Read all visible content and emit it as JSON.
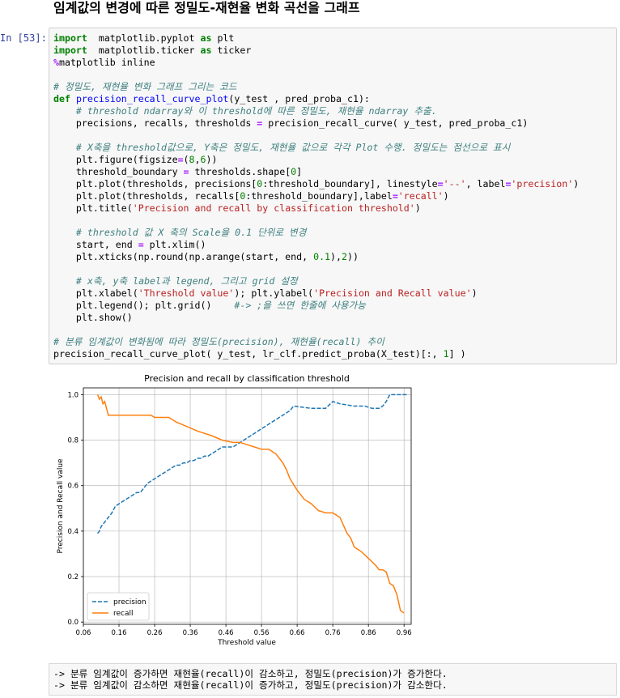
{
  "heading": "임계값의 변경에 따른 정밀도-재현율 변화 곡선을 그래프",
  "cell": {
    "prompt": "In [53]:",
    "lines": [
      [
        [
          "kw",
          "import"
        ],
        [
          "",
          "  matplotlib.pyplot "
        ],
        [
          "kw",
          "as"
        ],
        [
          "",
          " plt"
        ]
      ],
      [
        [
          "kw",
          "import"
        ],
        [
          "",
          "  matplotlib.ticker "
        ],
        [
          "kw",
          "as"
        ],
        [
          "",
          " ticker"
        ]
      ],
      [
        [
          "op",
          "%"
        ],
        [
          "",
          "matplotlib inline"
        ]
      ],
      [
        [
          "",
          ""
        ]
      ],
      [
        [
          "cm",
          "# 정밀도, 재현율 변화 그래프 그리는 코드"
        ]
      ],
      [
        [
          "kw",
          "def"
        ],
        [
          "",
          " "
        ],
        [
          "fn",
          "precision_recall_curve_plot"
        ],
        [
          "",
          "(y_test , pred_proba_c1):"
        ]
      ],
      [
        [
          "",
          "    "
        ],
        [
          "cm",
          "# threshold ndarray와 이 threshold에 따른 정밀도, 재현율 ndarray 추출."
        ]
      ],
      [
        [
          "",
          "    precisions, recalls, thresholds "
        ],
        [
          "op",
          "="
        ],
        [
          "",
          " precision_recall_curve( y_test, pred_proba_c1)"
        ]
      ],
      [
        [
          "",
          ""
        ]
      ],
      [
        [
          "",
          "    "
        ],
        [
          "cm",
          "# X축을 threshold값으로, Y축은 정밀도, 재현율 값으로 각각 Plot 수행. 정밀도는 점선으로 표시"
        ]
      ],
      [
        [
          "",
          "    plt.figure(figsize"
        ],
        [
          "op",
          "="
        ],
        [
          "",
          "("
        ],
        [
          "nm",
          "8"
        ],
        [
          "",
          ","
        ],
        [
          "nm",
          "6"
        ],
        [
          "",
          "))"
        ]
      ],
      [
        [
          "",
          "    threshold_boundary "
        ],
        [
          "op",
          "="
        ],
        [
          "",
          " thresholds.shape["
        ],
        [
          "nm",
          "0"
        ],
        [
          "",
          "]"
        ]
      ],
      [
        [
          "",
          "    plt.plot(thresholds, precisions["
        ],
        [
          "nm",
          "0"
        ],
        [
          "",
          ":threshold_boundary], linestyle"
        ],
        [
          "op",
          "="
        ],
        [
          "st",
          "'--'"
        ],
        [
          "",
          ", label"
        ],
        [
          "op",
          "="
        ],
        [
          "st",
          "'precision'"
        ],
        [
          "",
          ")"
        ]
      ],
      [
        [
          "",
          "    plt.plot(thresholds, recalls["
        ],
        [
          "nm",
          "0"
        ],
        [
          "",
          ":threshold_boundary],label"
        ],
        [
          "op",
          "="
        ],
        [
          "st",
          "'recall'"
        ],
        [
          "",
          ")"
        ]
      ],
      [
        [
          "",
          "    plt.title("
        ],
        [
          "st",
          "'Precision and recall by classification threshold'"
        ],
        [
          "",
          ")"
        ]
      ],
      [
        [
          "",
          ""
        ]
      ],
      [
        [
          "",
          "    "
        ],
        [
          "cm",
          "# threshold 값 X 축의 Scale을 0.1 단위로 변경"
        ]
      ],
      [
        [
          "",
          "    start, end "
        ],
        [
          "op",
          "="
        ],
        [
          "",
          " plt.xlim()"
        ]
      ],
      [
        [
          "",
          "    plt.xticks(np.round(np.arange(start, end, "
        ],
        [
          "nm",
          "0.1"
        ],
        [
          "",
          "),"
        ],
        [
          "nm",
          "2"
        ],
        [
          "",
          "))"
        ]
      ],
      [
        [
          "",
          ""
        ]
      ],
      [
        [
          "",
          "    "
        ],
        [
          "cm",
          "# x축, y축 label과 legend, 그리고 grid 설정"
        ]
      ],
      [
        [
          "",
          "    plt.xlabel("
        ],
        [
          "st",
          "'Threshold value'"
        ],
        [
          "",
          "); plt.ylabel("
        ],
        [
          "st",
          "'Precision and Recall value'"
        ],
        [
          "",
          ")"
        ]
      ],
      [
        [
          "",
          "    plt.legend(); plt.grid()    "
        ],
        [
          "cm",
          "#-> ;을 쓰면 한줄에 사용가능"
        ]
      ],
      [
        [
          "",
          "    plt.show()"
        ]
      ],
      [
        [
          "",
          ""
        ]
      ],
      [
        [
          "cm",
          "# 분류 임계값이 변화됨에 따라 정밀도(precision), 재현율(recall) 추이"
        ]
      ],
      [
        [
          "",
          "precision_recall_curve_plot( y_test, lr_clf.predict_proba(X_test)[:, "
        ],
        [
          "nm",
          "1"
        ],
        [
          "",
          "] )"
        ]
      ]
    ]
  },
  "chart_data": {
    "type": "line",
    "title": "Precision and recall by classification threshold",
    "xlabel": "Threshold value",
    "ylabel": "Precision and Recall value",
    "xlim": [
      0.06,
      0.98
    ],
    "ylim": [
      -0.01,
      1.03
    ],
    "xticks": [
      "0.06",
      "0.16",
      "0.26",
      "0.36",
      "0.46",
      "0.56",
      "0.66",
      "0.76",
      "0.86",
      "0.96"
    ],
    "yticks": [
      "0.0",
      "0.2",
      "0.4",
      "0.6",
      "0.8",
      "1.0"
    ],
    "grid": true,
    "legend_position": "lower-left",
    "series": [
      {
        "name": "precision",
        "color": "#1f77b4",
        "style": "dashed",
        "x": [
          0.1,
          0.105,
          0.11,
          0.115,
          0.12,
          0.125,
          0.13,
          0.14,
          0.15,
          0.16,
          0.17,
          0.18,
          0.19,
          0.2,
          0.21,
          0.22,
          0.23,
          0.24,
          0.25,
          0.26,
          0.27,
          0.28,
          0.29,
          0.3,
          0.31,
          0.32,
          0.33,
          0.34,
          0.35,
          0.36,
          0.37,
          0.38,
          0.39,
          0.4,
          0.41,
          0.42,
          0.43,
          0.44,
          0.45,
          0.46,
          0.47,
          0.48,
          0.49,
          0.5,
          0.51,
          0.52,
          0.53,
          0.54,
          0.55,
          0.56,
          0.57,
          0.58,
          0.59,
          0.6,
          0.61,
          0.62,
          0.63,
          0.64,
          0.65,
          0.7,
          0.74,
          0.76,
          0.78,
          0.82,
          0.85,
          0.87,
          0.89,
          0.9,
          0.91,
          0.92,
          0.95,
          0.97
        ],
        "values": [
          0.39,
          0.4,
          0.42,
          0.43,
          0.44,
          0.45,
          0.46,
          0.48,
          0.51,
          0.52,
          0.53,
          0.54,
          0.55,
          0.56,
          0.57,
          0.57,
          0.59,
          0.61,
          0.62,
          0.63,
          0.64,
          0.65,
          0.66,
          0.67,
          0.68,
          0.69,
          0.69,
          0.7,
          0.7,
          0.71,
          0.71,
          0.72,
          0.72,
          0.73,
          0.73,
          0.74,
          0.75,
          0.76,
          0.77,
          0.77,
          0.77,
          0.77,
          0.78,
          0.79,
          0.8,
          0.81,
          0.82,
          0.83,
          0.84,
          0.85,
          0.86,
          0.87,
          0.88,
          0.89,
          0.9,
          0.91,
          0.92,
          0.93,
          0.95,
          0.94,
          0.94,
          0.97,
          0.96,
          0.95,
          0.95,
          0.94,
          0.94,
          0.95,
          0.97,
          1.0,
          1.0,
          1.0
        ]
      },
      {
        "name": "recall",
        "color": "#ff7f0e",
        "style": "solid",
        "x": [
          0.1,
          0.105,
          0.11,
          0.115,
          0.12,
          0.125,
          0.13,
          0.2,
          0.25,
          0.26,
          0.3,
          0.32,
          0.35,
          0.38,
          0.4,
          0.42,
          0.45,
          0.48,
          0.5,
          0.52,
          0.54,
          0.56,
          0.58,
          0.6,
          0.61,
          0.62,
          0.63,
          0.64,
          0.66,
          0.68,
          0.7,
          0.72,
          0.74,
          0.76,
          0.78,
          0.8,
          0.81,
          0.82,
          0.84,
          0.86,
          0.88,
          0.89,
          0.9,
          0.91,
          0.92,
          0.93,
          0.94,
          0.95,
          0.96
        ],
        "values": [
          1.0,
          0.98,
          0.99,
          0.96,
          0.97,
          0.94,
          0.91,
          0.91,
          0.91,
          0.9,
          0.9,
          0.88,
          0.86,
          0.84,
          0.83,
          0.82,
          0.8,
          0.79,
          0.79,
          0.78,
          0.77,
          0.76,
          0.76,
          0.74,
          0.72,
          0.7,
          0.67,
          0.63,
          0.58,
          0.54,
          0.52,
          0.49,
          0.48,
          0.48,
          0.46,
          0.39,
          0.37,
          0.33,
          0.31,
          0.28,
          0.25,
          0.23,
          0.23,
          0.22,
          0.17,
          0.16,
          0.12,
          0.05,
          0.04
        ]
      }
    ]
  },
  "output": {
    "lines": [
      "-> 분류 임계값이 증가하면 재현율(recall)이 감소하고, 정밀도(precision)가 증가한다.",
      "-> 분류 임계값이 감소하면 재현율(recall)이 증가하고, 정밀도(precision)가 감소한다."
    ]
  }
}
